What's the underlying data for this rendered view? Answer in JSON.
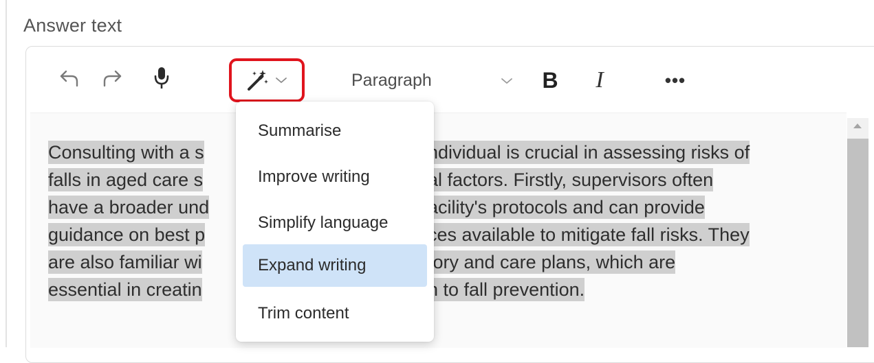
{
  "field": {
    "label": "Answer text"
  },
  "toolbar": {
    "icons": [
      "undo-icon",
      "redo-icon",
      "microphone-icon",
      "magic-wand-icon",
      "chevron-down-icon",
      "more-icon"
    ],
    "block_format": {
      "selected": "Paragraph"
    },
    "bold_label": "B",
    "italic_label": "I",
    "more_label": "•••",
    "highlight_color": "#e0141d"
  },
  "ai_menu": {
    "items": [
      {
        "label": "Summarise"
      },
      {
        "label": "Improve writing"
      },
      {
        "label": "Simplify language"
      },
      {
        "label": "Expand writing"
      },
      {
        "label": "Trim content"
      }
    ],
    "active_item": "Expand writing",
    "active_color": "#cfe3f8"
  },
  "editor": {
    "lines": [
      "Consulting with a s",
      "ndividual is crucial in assessing risks of",
      "falls in aged care s",
      "al factors. Firstly, supervisors often",
      "have a broader und",
      "acility's protocols and can provide",
      "guidance on best p",
      "ces available to mitigate fall risks. They",
      "are also familiar wi",
      "tory and care plans, which are",
      "essential in creatin",
      "h to fall prevention."
    ],
    "selection_color": "#cfcfcf"
  }
}
